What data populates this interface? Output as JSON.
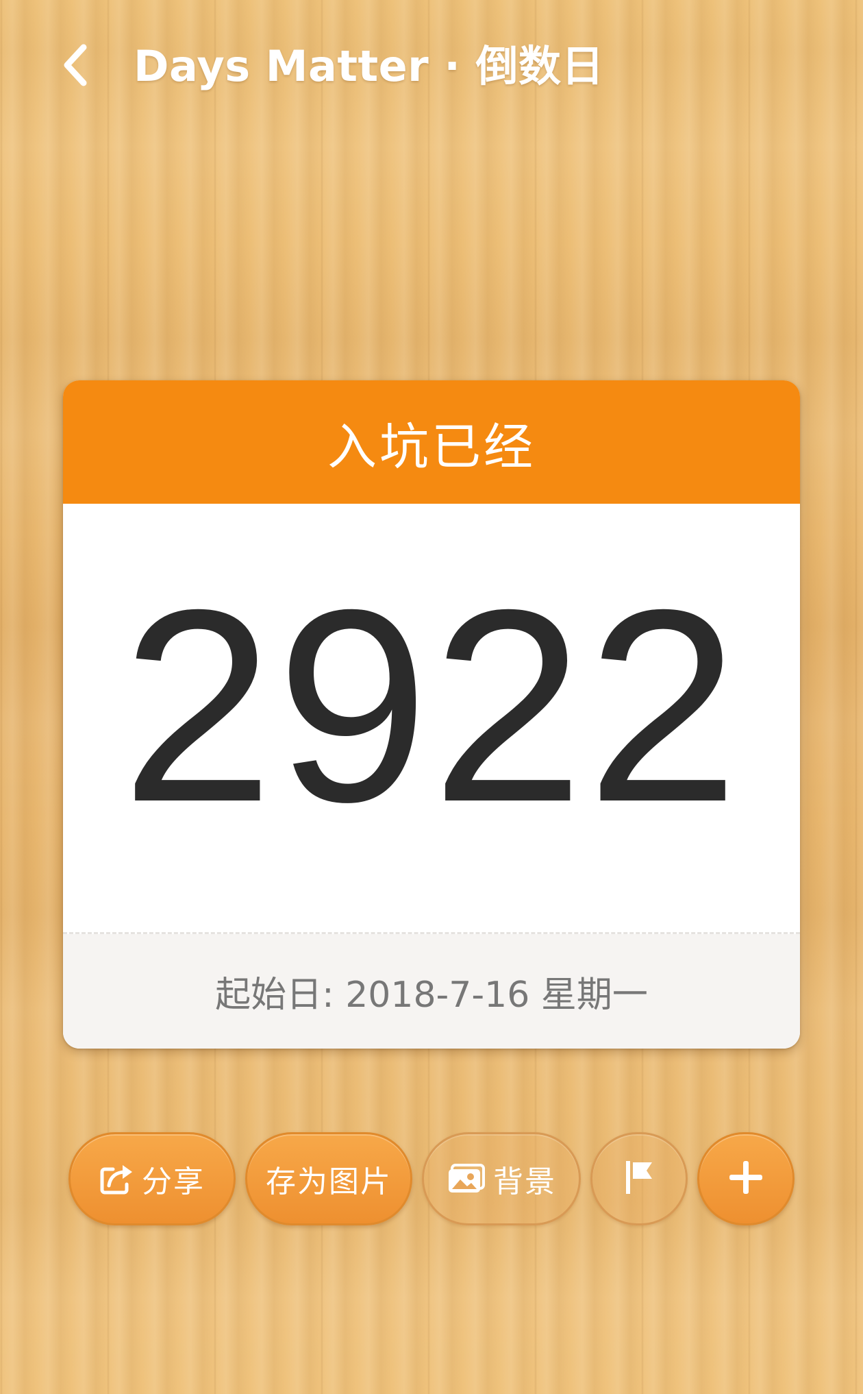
{
  "header": {
    "title": "Days Matter · 倒数日",
    "back_icon": "chevron-left-icon"
  },
  "card": {
    "title": "入坑已经",
    "days": "2922",
    "start_date": "起始日: 2018-7-16 星期一",
    "accent_color": "#f58a11"
  },
  "actions": {
    "share_label": "分享",
    "save_image_label": "存为图片",
    "background_label": "背景",
    "share_icon": "share-icon",
    "background_icon": "image-icon",
    "flag_icon": "flag-icon",
    "add_icon": "plus-icon"
  }
}
